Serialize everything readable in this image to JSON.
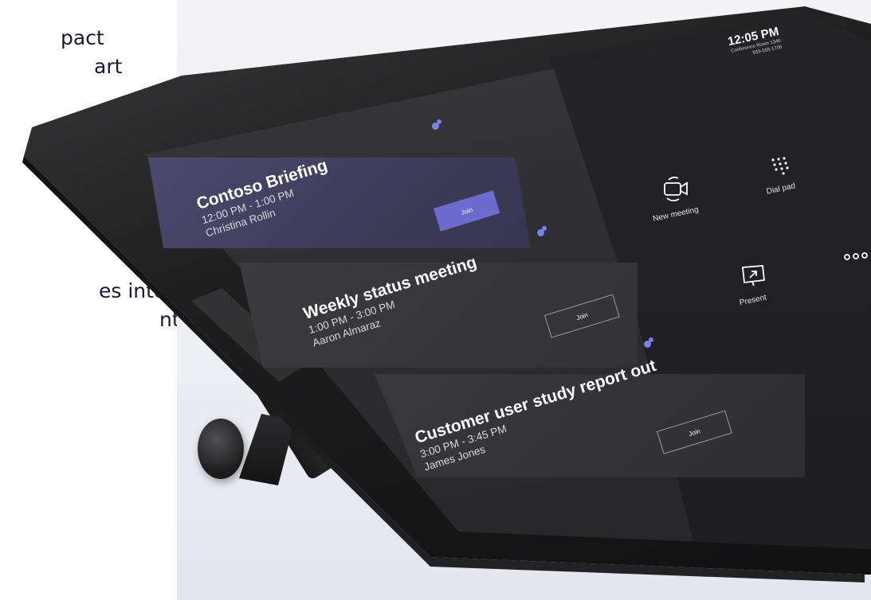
{
  "background_copy": {
    "line1": "pact",
    "line2": "art",
    "line3": "es into",
    "line4": "nt."
  },
  "device": {
    "status": {
      "time": "12:05 PM",
      "room": "Conference Room 1346",
      "phone": "555-555-1706"
    },
    "meetings": [
      {
        "title": "Contoso Briefing",
        "time": "12:00 PM - 1:00 PM",
        "organizer": "Christina Rollin",
        "join_label": "Join"
      },
      {
        "title": "Weekly status meeting",
        "time": "1:00 PM - 3:00 PM",
        "organizer": "Aaron Almaraz",
        "join_label": "Join"
      },
      {
        "title": "Customer user study report out",
        "time": "3:00 PM - 3:45 PM",
        "organizer": "James Jones",
        "join_label": "Join"
      }
    ],
    "actions": {
      "new_meeting": "New meeting",
      "dial_pad": "Dial pad",
      "present": "Present"
    },
    "colors": {
      "accent": "#6e6bcf",
      "teams": "#7b83eb",
      "screen": "#2e2e31"
    }
  }
}
